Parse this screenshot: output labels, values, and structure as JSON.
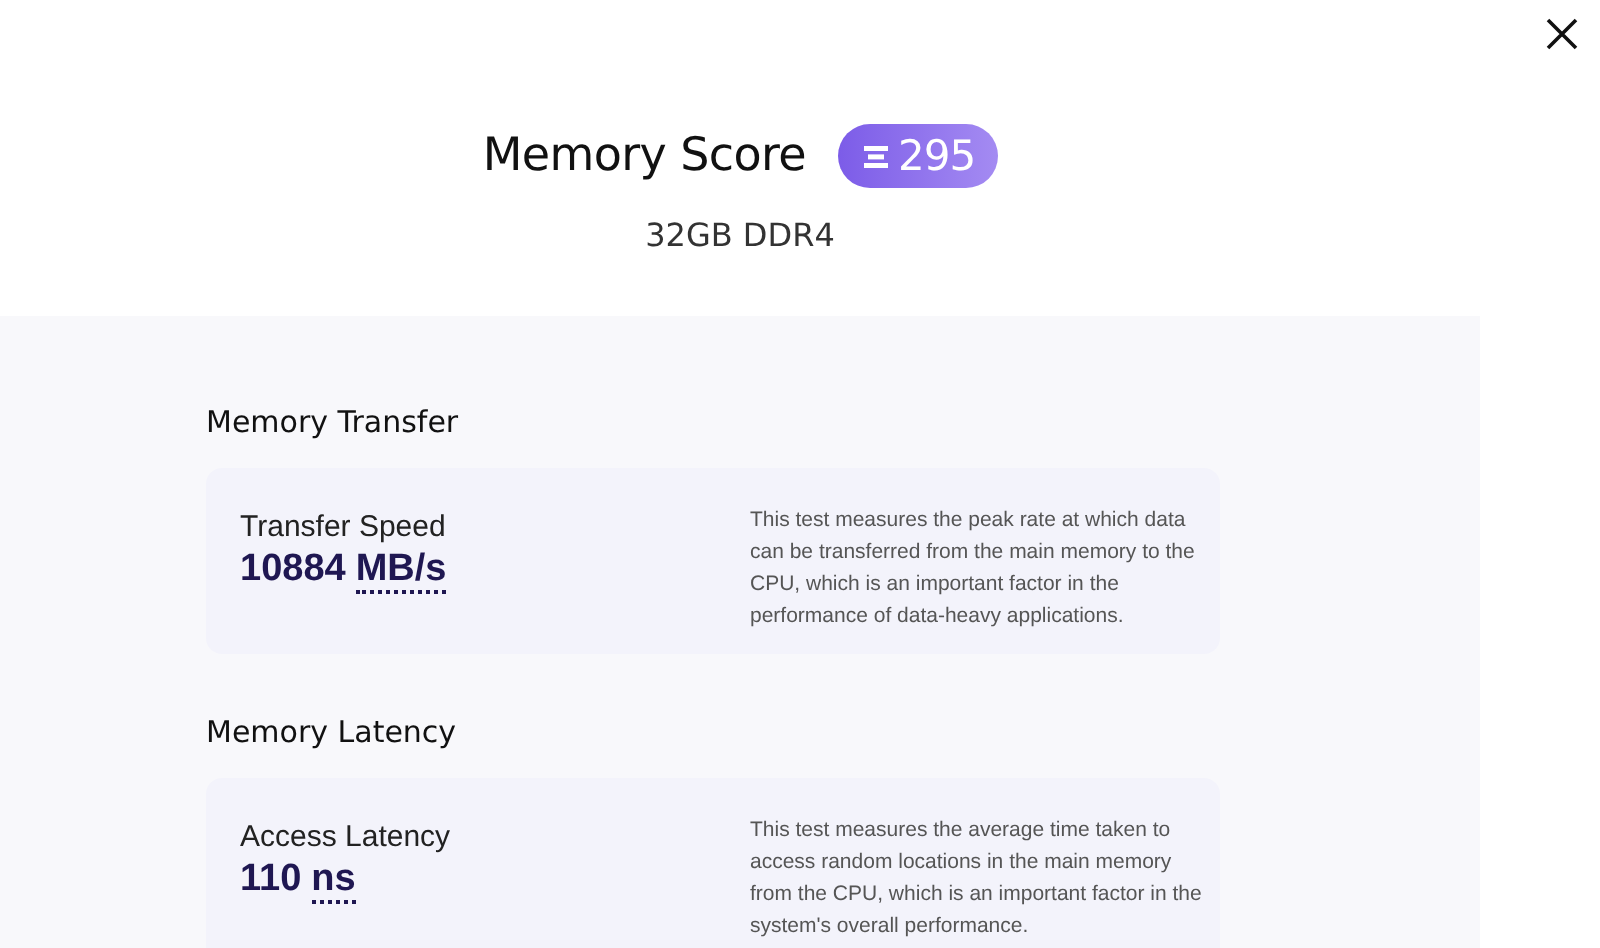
{
  "header": {
    "title": "Memory Score",
    "score": "295",
    "subtitle": "32GB DDR4"
  },
  "sections": [
    {
      "heading": "Memory Transfer",
      "metric": {
        "label": "Transfer Speed",
        "value": "10884",
        "unit": "MB/s",
        "description": "This test measures the peak rate at which data can be transferred from the main memory to the CPU, which is an important factor in the performance of data-heavy applications."
      }
    },
    {
      "heading": "Memory Latency",
      "metric": {
        "label": "Access Latency",
        "value": "110",
        "unit": "ns",
        "description": "This test measures the average time taken to access random locations in the main memory from the CPU, which is an important factor in the system's overall performance."
      }
    }
  ]
}
